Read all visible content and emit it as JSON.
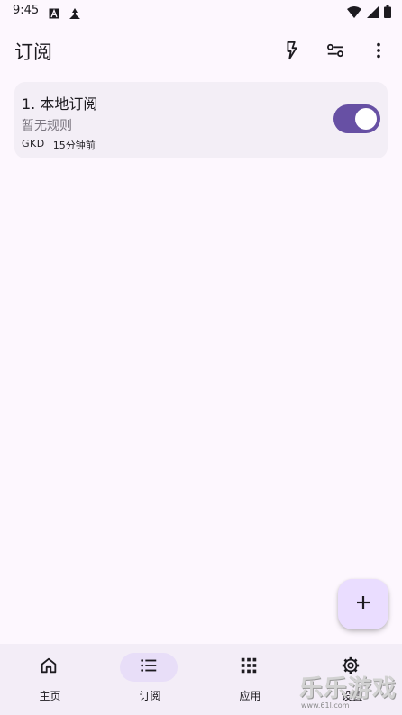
{
  "status_bar": {
    "time": "9:45",
    "left_icons": [
      "font-icon",
      "navigation-icon"
    ],
    "right_icons": [
      "wifi-icon",
      "cellular-icon",
      "battery-icon"
    ]
  },
  "header": {
    "title": "订阅",
    "actions": [
      "lightning-icon",
      "filter-icon",
      "more-vert-icon"
    ]
  },
  "subscriptions": [
    {
      "title": "1. 本地订阅",
      "description": "暂无规则",
      "source": "GKD",
      "updated": "15分钟前",
      "enabled": true
    }
  ],
  "fab": {
    "icon": "plus-icon"
  },
  "bottom_nav": {
    "items": [
      {
        "label": "主页",
        "icon": "home-icon",
        "active": false
      },
      {
        "label": "订阅",
        "icon": "list-icon",
        "active": true
      },
      {
        "label": "应用",
        "icon": "grid-icon",
        "active": false
      },
      {
        "label": "设置",
        "icon": "gear-icon",
        "active": false
      }
    ]
  },
  "watermark": {
    "text": "乐乐游戏",
    "url": "www.61l.com"
  },
  "colors": {
    "background": "#fdf7fe",
    "card": "#f3eef6",
    "accent": "#6750a4",
    "fab": "#eaddff",
    "nav_bar": "#f3edf7",
    "nav_active_pill": "#e8def8"
  }
}
